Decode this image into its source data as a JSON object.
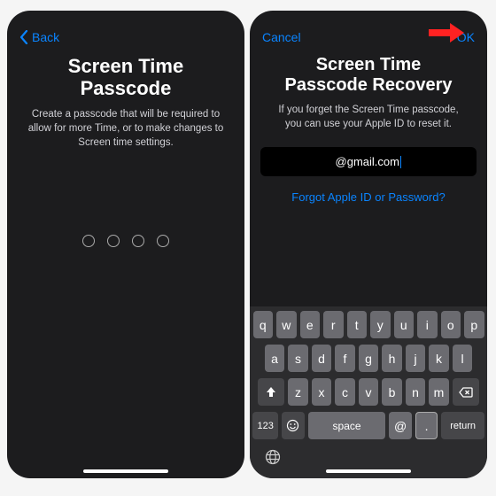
{
  "left": {
    "back": "Back",
    "title": "Screen Time Passcode",
    "desc": "Create a passcode that will be required to allow for more Time, or to make changes to Screen time settings."
  },
  "right": {
    "cancel": "Cancel",
    "ok": "OK",
    "title_line1": "Screen Time",
    "title_line2": "Passcode Recovery",
    "desc": "If you forget the Screen Time passcode, you can use your Apple ID to reset it.",
    "email": "@gmail.com",
    "forgot": "Forgot Apple ID or Password?"
  },
  "kb": {
    "r1": [
      "q",
      "w",
      "e",
      "r",
      "t",
      "y",
      "u",
      "i",
      "o",
      "p"
    ],
    "r2": [
      "a",
      "s",
      "d",
      "f",
      "g",
      "h",
      "j",
      "k",
      "l"
    ],
    "r3": [
      "z",
      "x",
      "c",
      "v",
      "b",
      "n",
      "m"
    ],
    "num": "123",
    "space": "space",
    "at": "@",
    "dot": ".",
    "ret": "return"
  }
}
